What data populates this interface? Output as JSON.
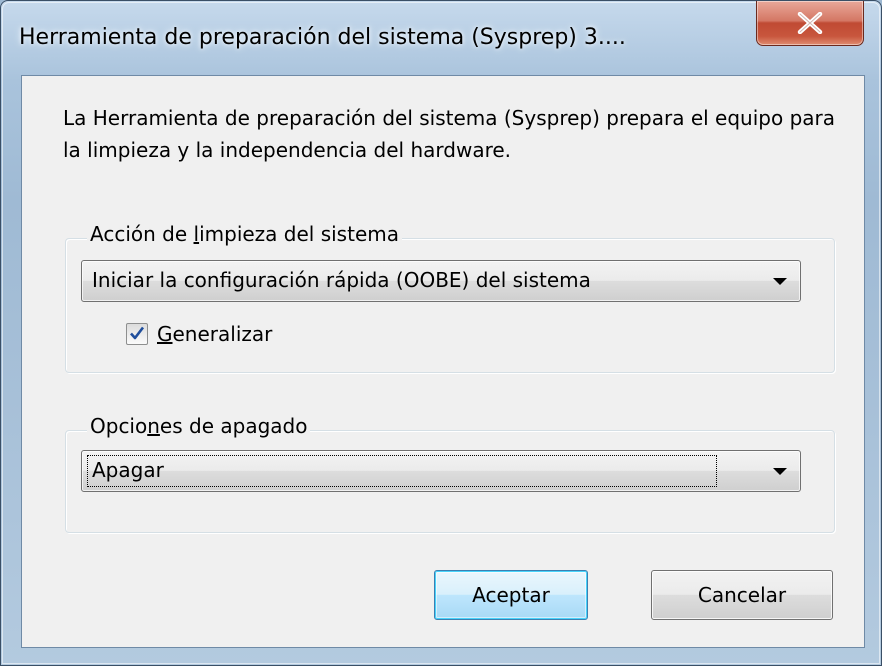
{
  "window": {
    "title": "Herramienta de preparación del sistema (Sysprep) 3....",
    "close_label": "X"
  },
  "description": "La Herramienta de preparación del sistema (Sysprep) prepara el equipo para la limpieza y la independencia del hardware.",
  "cleanup_group": {
    "label_before": "Acción de ",
    "label_mnemonic": "l",
    "label_after": "impieza del sistema",
    "selected_action": "Iniciar la configuración rápida (OOBE) del sistema",
    "generalize": {
      "checked": true,
      "label_mnemonic": "G",
      "label_rest": "eneralizar"
    }
  },
  "shutdown_group": {
    "label_before": "Opcio",
    "label_mnemonic": "n",
    "label_after": "es de apagado",
    "selected_option": "Apagar"
  },
  "buttons": {
    "ok_label": "Aceptar",
    "cancel_label": "Cancelar"
  },
  "colors": {
    "close_button": "#c8563d",
    "default_button_border": "#3c7fb1",
    "dialog_background": "#f0f0f0"
  }
}
